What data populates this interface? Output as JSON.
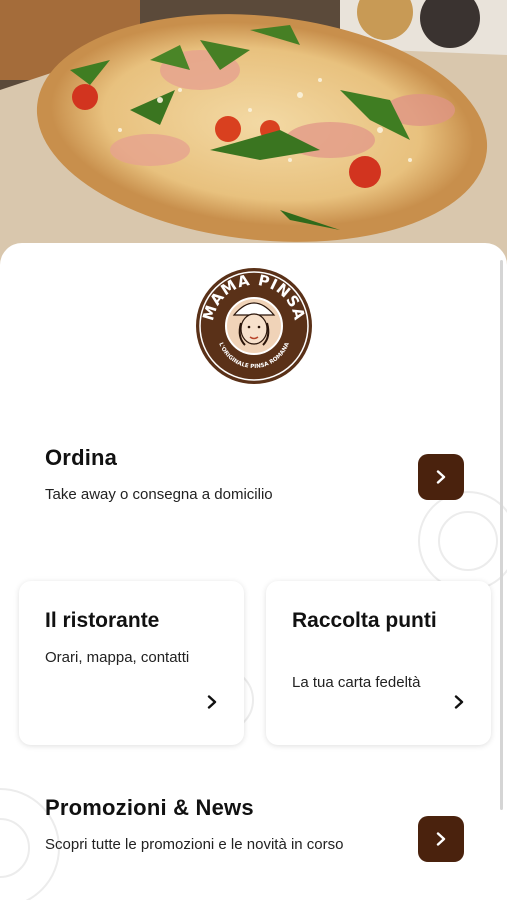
{
  "hero": {
    "image": "pinsa-with-prosciutto-arugula-photo"
  },
  "brand": {
    "name": "MAMA PINSA",
    "tagline": "L'ORIGINALE PINSA ROMANA",
    "primary_color": "#4a220d",
    "logo_ring_color": "#5a3118"
  },
  "order": {
    "title": "Ordina",
    "subtitle": "Take away o consegna a domicilio",
    "icon": "chevron-right-icon"
  },
  "cards": [
    {
      "title": "Il ristorante",
      "subtitle": "Orari, mappa, contatti",
      "icon": "chevron-right-icon"
    },
    {
      "title": "Raccolta punti",
      "subtitle": "La tua carta fedeltà",
      "icon": "chevron-right-icon"
    }
  ],
  "promo": {
    "title": "Promozioni & News",
    "subtitle": "Scopri tutte le promozioni e le novità in corso",
    "icon": "chevron-right-icon"
  }
}
